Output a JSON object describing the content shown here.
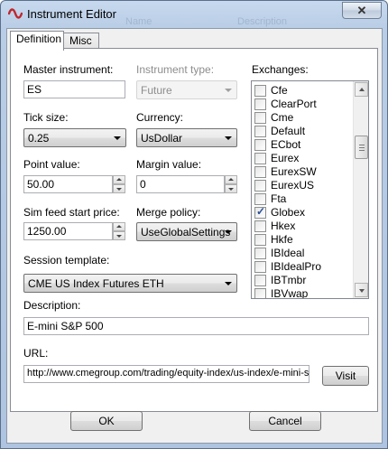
{
  "window": {
    "title": "Instrument Editor",
    "close_glyph": "✕",
    "ghost_headers": [
      "Name",
      "Description"
    ]
  },
  "tabs": [
    {
      "label": "Definition",
      "active": true
    },
    {
      "label": "Misc",
      "active": false
    }
  ],
  "form": {
    "master_instrument": {
      "label": "Master instrument:",
      "value": "ES"
    },
    "instrument_type": {
      "label": "Instrument type:",
      "value": "Future",
      "enabled": false
    },
    "tick_size": {
      "label": "Tick size:",
      "value": "0.25"
    },
    "currency": {
      "label": "Currency:",
      "value": "UsDollar"
    },
    "point_value": {
      "label": "Point value:",
      "value": "50.00"
    },
    "margin_value": {
      "label": "Margin value:",
      "value": "0"
    },
    "sim_feed_start_price": {
      "label": "Sim feed start price:",
      "value": "1250.00"
    },
    "merge_policy": {
      "label": "Merge policy:",
      "value": "UseGlobalSettings"
    },
    "session_template": {
      "label": "Session template:",
      "value": "CME US Index Futures ETH"
    },
    "description": {
      "label": "Description:",
      "value": "E-mini S&P 500"
    },
    "url": {
      "label": "URL:",
      "value": "http://www.cmegroup.com/trading/equity-index/us-index/e-mini-s",
      "visit_label": "Visit"
    }
  },
  "exchanges": {
    "label": "Exchanges:",
    "items": [
      {
        "label": "Cfe",
        "checked": false
      },
      {
        "label": "ClearPort",
        "checked": false
      },
      {
        "label": "Cme",
        "checked": false
      },
      {
        "label": "Default",
        "checked": false
      },
      {
        "label": "ECbot",
        "checked": false
      },
      {
        "label": "Eurex",
        "checked": false
      },
      {
        "label": "EurexSW",
        "checked": false
      },
      {
        "label": "EurexUS",
        "checked": false
      },
      {
        "label": "Fta",
        "checked": false
      },
      {
        "label": "Globex",
        "checked": true
      },
      {
        "label": "Hkex",
        "checked": false
      },
      {
        "label": "Hkfe",
        "checked": false
      },
      {
        "label": "IBIdeal",
        "checked": false
      },
      {
        "label": "IBIdealPro",
        "checked": false
      },
      {
        "label": "IBTmbr",
        "checked": false
      },
      {
        "label": "IBVwap",
        "checked": false
      }
    ],
    "check_glyph": "✓"
  },
  "footer": {
    "ok_label": "OK",
    "cancel_label": "Cancel"
  },
  "colors": {
    "title_gradient_top": "#c7d9ee",
    "check_color": "#2a4f96",
    "icon_red": "#c0262d"
  }
}
